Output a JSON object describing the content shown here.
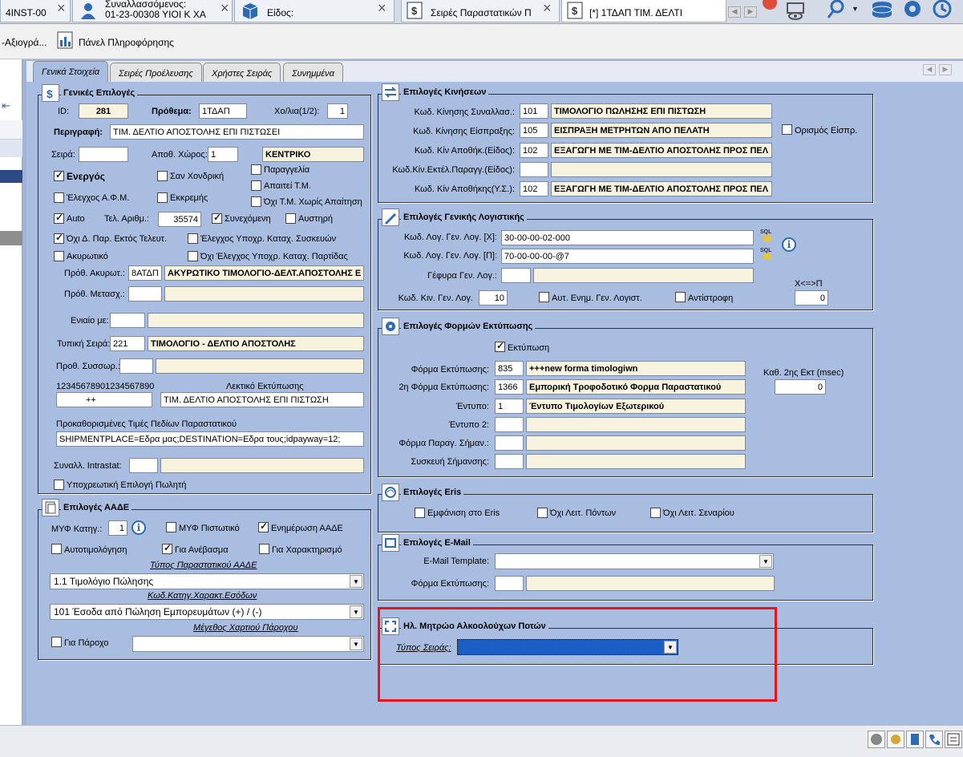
{
  "top_tabs": [
    {
      "label": "4INST-00"
    },
    {
      "line1": "Συναλλασσόμενος:",
      "line2": "01-23-00308  ΥΙΟΙ Κ ΧΑ"
    },
    {
      "label": "Είδος:"
    },
    {
      "label": "Σειρές Παραστατικών Π"
    },
    {
      "label": "[*] 1ΤΔΑΠ  ΤΙΜ. ΔΕΛΤΙ"
    }
  ],
  "toolbar": {
    "item1": "-Αξιογρά...",
    "item2": "Πάνελ Πληροφόρησης"
  },
  "inner_tabs": [
    "Γενικά Στοιχεία",
    "Σειρές Προέλευσης",
    "Χρήστες Σειράς",
    "Συνημμένα"
  ],
  "general": {
    "title": "Γενικές Επιλογές",
    "id_label": "ID:",
    "id_value": "281",
    "prefix_label": "Πρόθεμα:",
    "prefix_value": "1ΤΔΑΠ",
    "xo_label": "Χο/λια(1/2):",
    "xo_value": "1",
    "desc_label": "Περιγραφή:",
    "desc_value": "ΤΙΜ. ΔΕΛΤΙΟ ΑΠΟΣΤΟΛΗΣ ΕΠΙ ΠΙΣΤΩΣΕΙ",
    "series_label": "Σειρά:",
    "series_value": "",
    "warehouse_label": "Αποθ. Χώρος:",
    "warehouse_code": "1",
    "warehouse_name": "ΚΕΝΤΡΙΚΟ",
    "active": "Ενεργός",
    "wholesale": "Σαν Χονδρική",
    "order": "Παραγγελία",
    "required_tm": "Απαιτεί Τ.Μ.",
    "afm_check": "Έλεγχος Α.Φ.Μ.",
    "pending": "Εκκρεμής",
    "no_tm": "Όχι Τ.Μ. Χωρίς Απαίτηση",
    "auto": "Auto",
    "last_num_label": "Τελ. Αριθμ.:",
    "last_num_value": "35574",
    "continuous": "Συνεχόμενη",
    "strict": "Αυστηρή",
    "no_dpar": "Όχι Δ. Παρ. Εκτός Τελευτ.",
    "check_devices": "Έλεγχος Υποχρ. Καταχ. Συσκευών",
    "void": "Ακυρωτικό",
    "no_check_batch": "Όχι Έλεγχος Υποχρ. Καταχ. Παρτίδας",
    "void_prefix_label": "Πρόθ. Ακυρωτ.:",
    "void_prefix_value": "8ΑΤΔΠ",
    "void_prefix_name": "ΑΚΥΡΩΤΙΚΟ ΤΙΜΟΛΟΓΙΟ-ΔΕΛΤ.ΑΠΟΣΤΟΛΗΣ Ε",
    "transfer_label": "Πρόθ. Μετασχ.:",
    "unified_label": "Ενιαίο με:",
    "typical_label": "Τυπική Σειρά:",
    "typical_code": "221",
    "typical_name": "ΤΙΜΟΛΟΓΙΟ - ΔΕΛΤΙΟ ΑΠΟΣΤΟΛΗΣ",
    "accum_label": "Προθ. Συσσωρ.:",
    "digits": "12345678901234567890",
    "print_text_label": "Λεκτικό Εκτύπωσης",
    "plusplus": "++",
    "print_text_value": "ΤΙΜ. ΔΕΛΤΙΟ ΑΠΟΣΤΟΛΗΣ ΕΠΙ ΠΙΣΤΩΣΗ",
    "predefined_label": "Προκαθορισμένες Τιμές Πεδίων Παραστατικού",
    "predefined_value": "SHIPMENTPLACE=Εδρα μας;DESTINATION=Εδρα τους;idpayway=12;",
    "intrastat_label": "Συναλλ. Intrastat:",
    "seller_required": "Υποχρεωτική Επιλογή Πωλητή"
  },
  "aade": {
    "title": "Επιλογές ΑΑΔΕ",
    "myf_label": "ΜΥΦ Κατηγ.:",
    "myf_value": "1",
    "myf_credit": "ΜΥΦ Πιστωτικό",
    "update": "Ενημέρωση ΑΑΔΕ",
    "self_billing": "Αυτοτιμολόγηση",
    "upload": "Για Ανέβασμα",
    "classify": "Για Χαρακτηρισμό",
    "doc_type_label": "Τύπος Παραστατικού ΑΑΔΕ",
    "doc_type_value": "1.1  Τιμολόγιο Πώλησης",
    "income_label": "Κωδ.Κατηγ.Χαρακτ.Εσόδων",
    "income_value": "101  Έσοδα από Πώληση Εμπορευμάτων (+) / (-)",
    "paper_label": "Μέγεθος Χαρτιού Πάροχου",
    "provider": "Για Πάροχο"
  },
  "movements": {
    "title": "Επιλογές Κινήσεων",
    "rows": [
      {
        "label": "Κωδ. Κίνησης Συναλλασ.:",
        "code": "101",
        "name": "ΤΙΜΟΛΟΓΙΟ ΠΩΛΗΣΗΣ ΕΠΙ ΠΙΣΤΩΣΗ"
      },
      {
        "label": "Κωδ. Κίνησης Είσπραξης:",
        "code": "105",
        "name": "ΕΙΣΠΡΑΞΗ ΜΕΤΡΗΤΩΝ ΑΠΟ ΠΕΛΑΤΗ"
      },
      {
        "label": "Κωδ. Κίν Αποθήκ.(Είδος):",
        "code": "102",
        "name": "ΕΞΑΓΩΓΗ ΜΕ ΤΙΜ-ΔΕΛΤΙΟ ΑΠΟΣΤΟΛΗΣ ΠΡΟΣ ΠΕΛ"
      },
      {
        "label": "Κωδ.Κίν.Εκτέλ.Παραγγ.(Είδος):",
        "code": "",
        "name": ""
      },
      {
        "label": "Κωδ. Κίν Αποθήκης(Υ.Σ.):",
        "code": "102",
        "name": "ΕΞΑΓΩΓΗ ΜΕ ΤΙΜ-ΔΕΛΤΙΟ ΑΠΟΣΤΟΛΗΣ ΠΡΟΣ ΠΕΛ"
      }
    ],
    "receipt_def": "Ορισμός Είσπρ."
  },
  "accounting": {
    "title": "Επιλογές Γενικής Λογιστικής",
    "x_label": "Κωδ. Λογ. Γεν. Λογ. [Χ]:",
    "x_value": "30-00-00-02-000",
    "p_label": "Κωδ. Λογ. Γεν. Λογ. [Π]:",
    "p_value": "70-00-00-00-@7",
    "bridge_label": "Γέφυρα Γεν. Λογ.:",
    "mov_label": "Κωδ. Κιν. Γεν. Λογ.",
    "mov_value": "10",
    "auto_update": "Αυτ. Ενημ. Γεν. Λογιστ.",
    "reverse": "Αντίστροφη",
    "xp_label": "Χ<=>Π",
    "xp_value": "0",
    "sql": "SQL"
  },
  "print": {
    "title": "Επιλογές Φορμών Εκτύπωσης",
    "print_chk": "Εκτύπωση",
    "form_label": "Φόρμα Εκτύπωσης:",
    "form_code": "835",
    "form_name": "+++new forma timologiwn",
    "form2_label": "2η Φόρμα Εκτύπωσης:",
    "form2_code": "1366",
    "form2_name": "Εμπορική Τροφοδοτικό Φορμα Παραστατικού",
    "delay_label": "Καθ. 2ης Εκτ (msec)",
    "delay_value": "0",
    "printed_label": "Έντυπο:",
    "printed_code": "1",
    "printed_name": "Έντυπο Τιμολογίων Εξωτερικού",
    "printed2_label": "Έντυπο 2:",
    "mark_label": "Φόρμα Παραγ. Σήμαν.:",
    "device_label": "Συσκευή Σήμανσης:"
  },
  "eris": {
    "title": "Επιλογές Eris",
    "show": "Εμφάνιση στο Eris",
    "no_points": "Όχι Λειτ. Πόντων",
    "no_scenario": "Όχι Λειτ. Σεναρίου"
  },
  "email": {
    "title": "Επιλογές E-Mail",
    "template_label": "E-Mail Template:",
    "form_label": "Φόρμα Εκτύπωσης:"
  },
  "alcohol": {
    "title": "Ηλ. Μητρώο Αλκοολούχων Ποτών",
    "type_label": "Τύπος Σειράς:",
    "highlight_color": "#e8141c"
  },
  "colors": {
    "panel": "#a9bde0",
    "yellow_field": "#f7f3df",
    "selection": "#1c5fc4"
  }
}
